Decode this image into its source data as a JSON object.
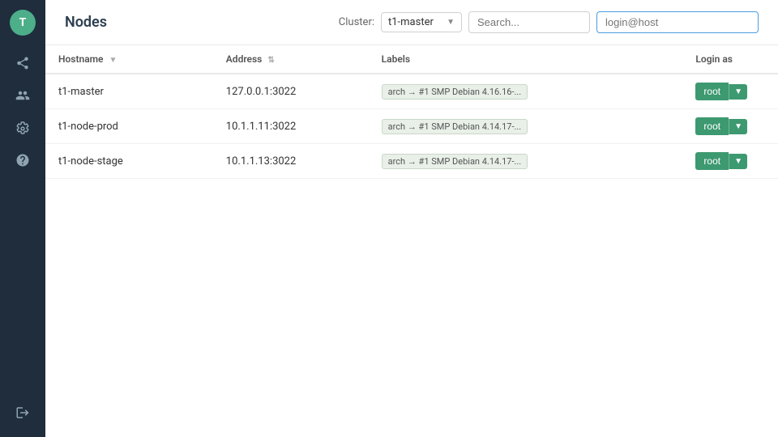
{
  "page": {
    "title": "Nodes"
  },
  "sidebar": {
    "avatar_letter": "T",
    "items": [
      {
        "name": "share-icon",
        "label": "Share"
      },
      {
        "name": "users-icon",
        "label": "Users"
      },
      {
        "name": "wrench-icon",
        "label": "Settings"
      },
      {
        "name": "help-icon",
        "label": "Help"
      },
      {
        "name": "logout-icon",
        "label": "Logout"
      }
    ]
  },
  "header": {
    "cluster_label": "Cluster:",
    "cluster_value": "t1-master",
    "search_placeholder": "Search...",
    "login_host_placeholder": "login@host"
  },
  "table": {
    "columns": [
      {
        "id": "hostname",
        "label": "Hostname",
        "sortable": true
      },
      {
        "id": "address",
        "label": "Address",
        "sortable": true
      },
      {
        "id": "labels",
        "label": "Labels",
        "sortable": false
      },
      {
        "id": "loginas",
        "label": "Login as",
        "sortable": false
      }
    ],
    "rows": [
      {
        "hostname": "t1-master",
        "address": "127.0.0.1:3022",
        "labels": "arch → #1 SMP Debian 4.16.16-...",
        "login_btn": "root"
      },
      {
        "hostname": "t1-node-prod",
        "address": "10.1.1.11:3022",
        "labels": "arch → #1 SMP Debian 4.14.17-...",
        "login_btn": "root"
      },
      {
        "hostname": "t1-node-stage",
        "address": "10.1.1.13:3022",
        "labels": "arch → #1 SMP Debian 4.14.17-...",
        "login_btn": "root"
      }
    ]
  }
}
